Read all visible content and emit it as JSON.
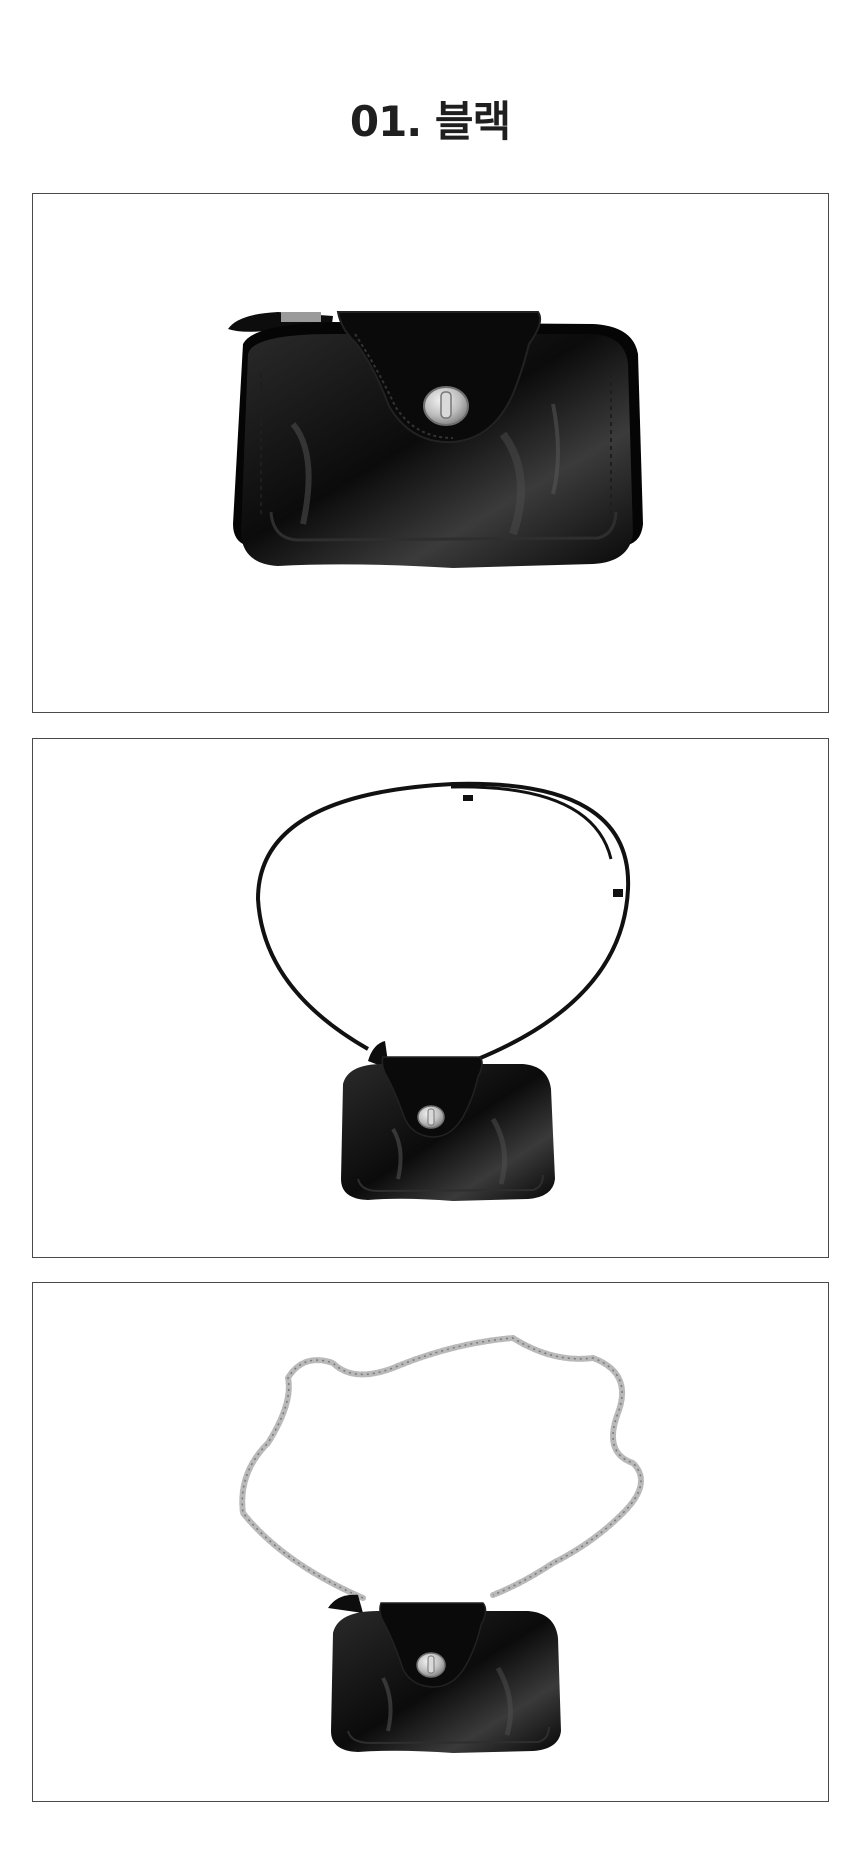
{
  "header": {
    "title": "01. 블랙"
  },
  "colors": {
    "bag": "#0d0d0d",
    "bag_highlight": "#3a3a3a",
    "hardware": "#c8c8c8",
    "chain": "#b8b8b8",
    "frame": "#4a4a4a"
  },
  "images": [
    {
      "name": "bag-front-view",
      "icon": "bag-icon"
    },
    {
      "name": "bag-with-leather-strap",
      "icon": "bag-icon"
    },
    {
      "name": "bag-with-chain-strap",
      "icon": "bag-icon"
    }
  ]
}
